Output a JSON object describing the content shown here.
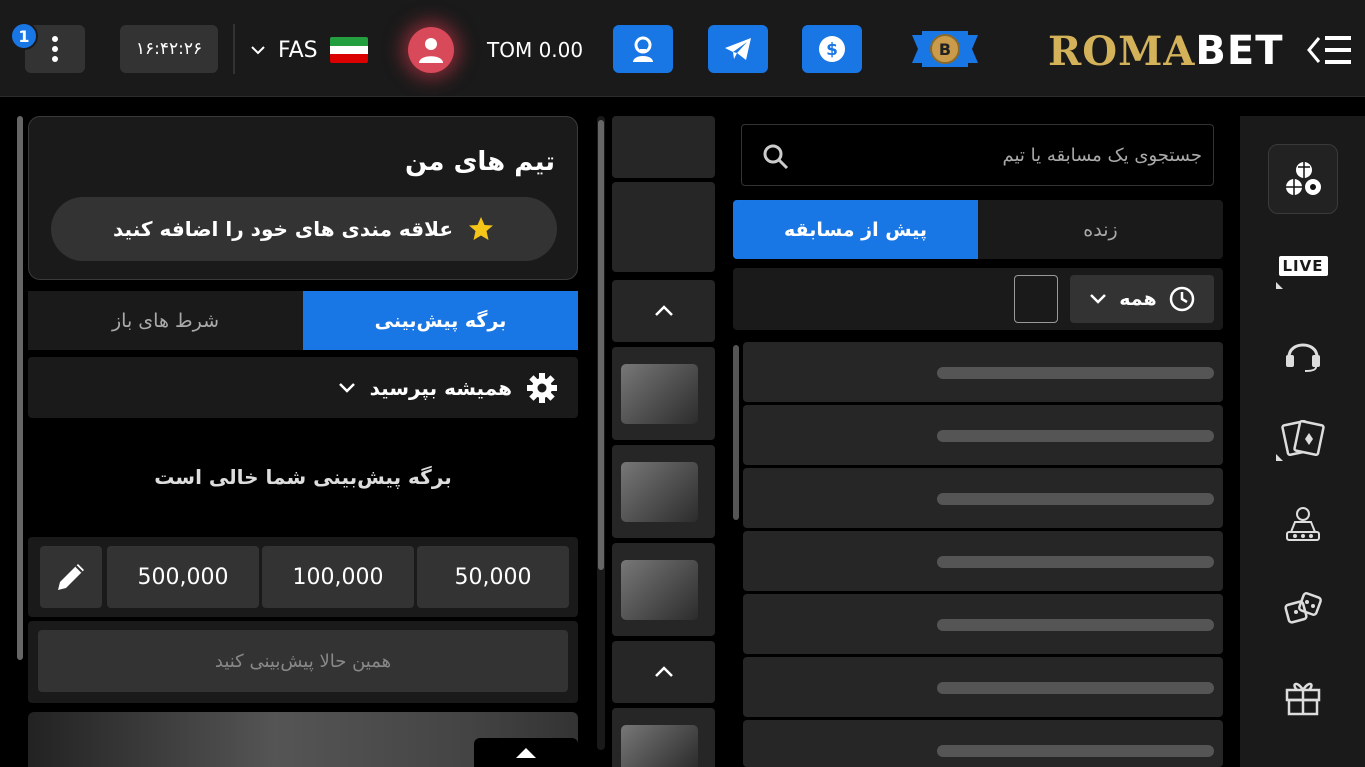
{
  "header": {
    "notification_count": "1",
    "clock": "۱۶:۴۲:۲۶",
    "language": "FAS",
    "balance": "TOM 0.00",
    "logo_roma": "ROMA",
    "logo_bet": "BET"
  },
  "sidebar": {
    "items": [
      {
        "icon": "sports-balls-icon"
      },
      {
        "icon": "live-icon",
        "label": "LIVE"
      },
      {
        "icon": "headset-icon"
      },
      {
        "icon": "cards-icon"
      },
      {
        "icon": "dealer-icon"
      },
      {
        "icon": "dice-icon"
      },
      {
        "icon": "gift-icon"
      }
    ]
  },
  "sports": {
    "search_placeholder": "جستجوی یک مسابقه یا تیم",
    "tab_prematch": "پیش از مسابقه",
    "tab_live": "زنده",
    "filter_all": "همه"
  },
  "betslip": {
    "my_teams_title": "تیم های من",
    "add_favorites": "علاقه مندی های خود را اضافه کنید",
    "tab_slip": "برگه پیش‌بینی",
    "tab_open_bets": "شرط های باز",
    "always_ask": "همیشه بپرسید",
    "empty_message": "برگه پیش‌بینی شما خالی است",
    "amounts": [
      "50,000",
      "100,000",
      "500,000"
    ],
    "place_bet": "همین حالا پیش‌بینی کنید"
  },
  "colors": {
    "accent": "#1976e5",
    "gold": "#d4b25a",
    "background": "#000000",
    "panel": "#1a1a1a"
  }
}
